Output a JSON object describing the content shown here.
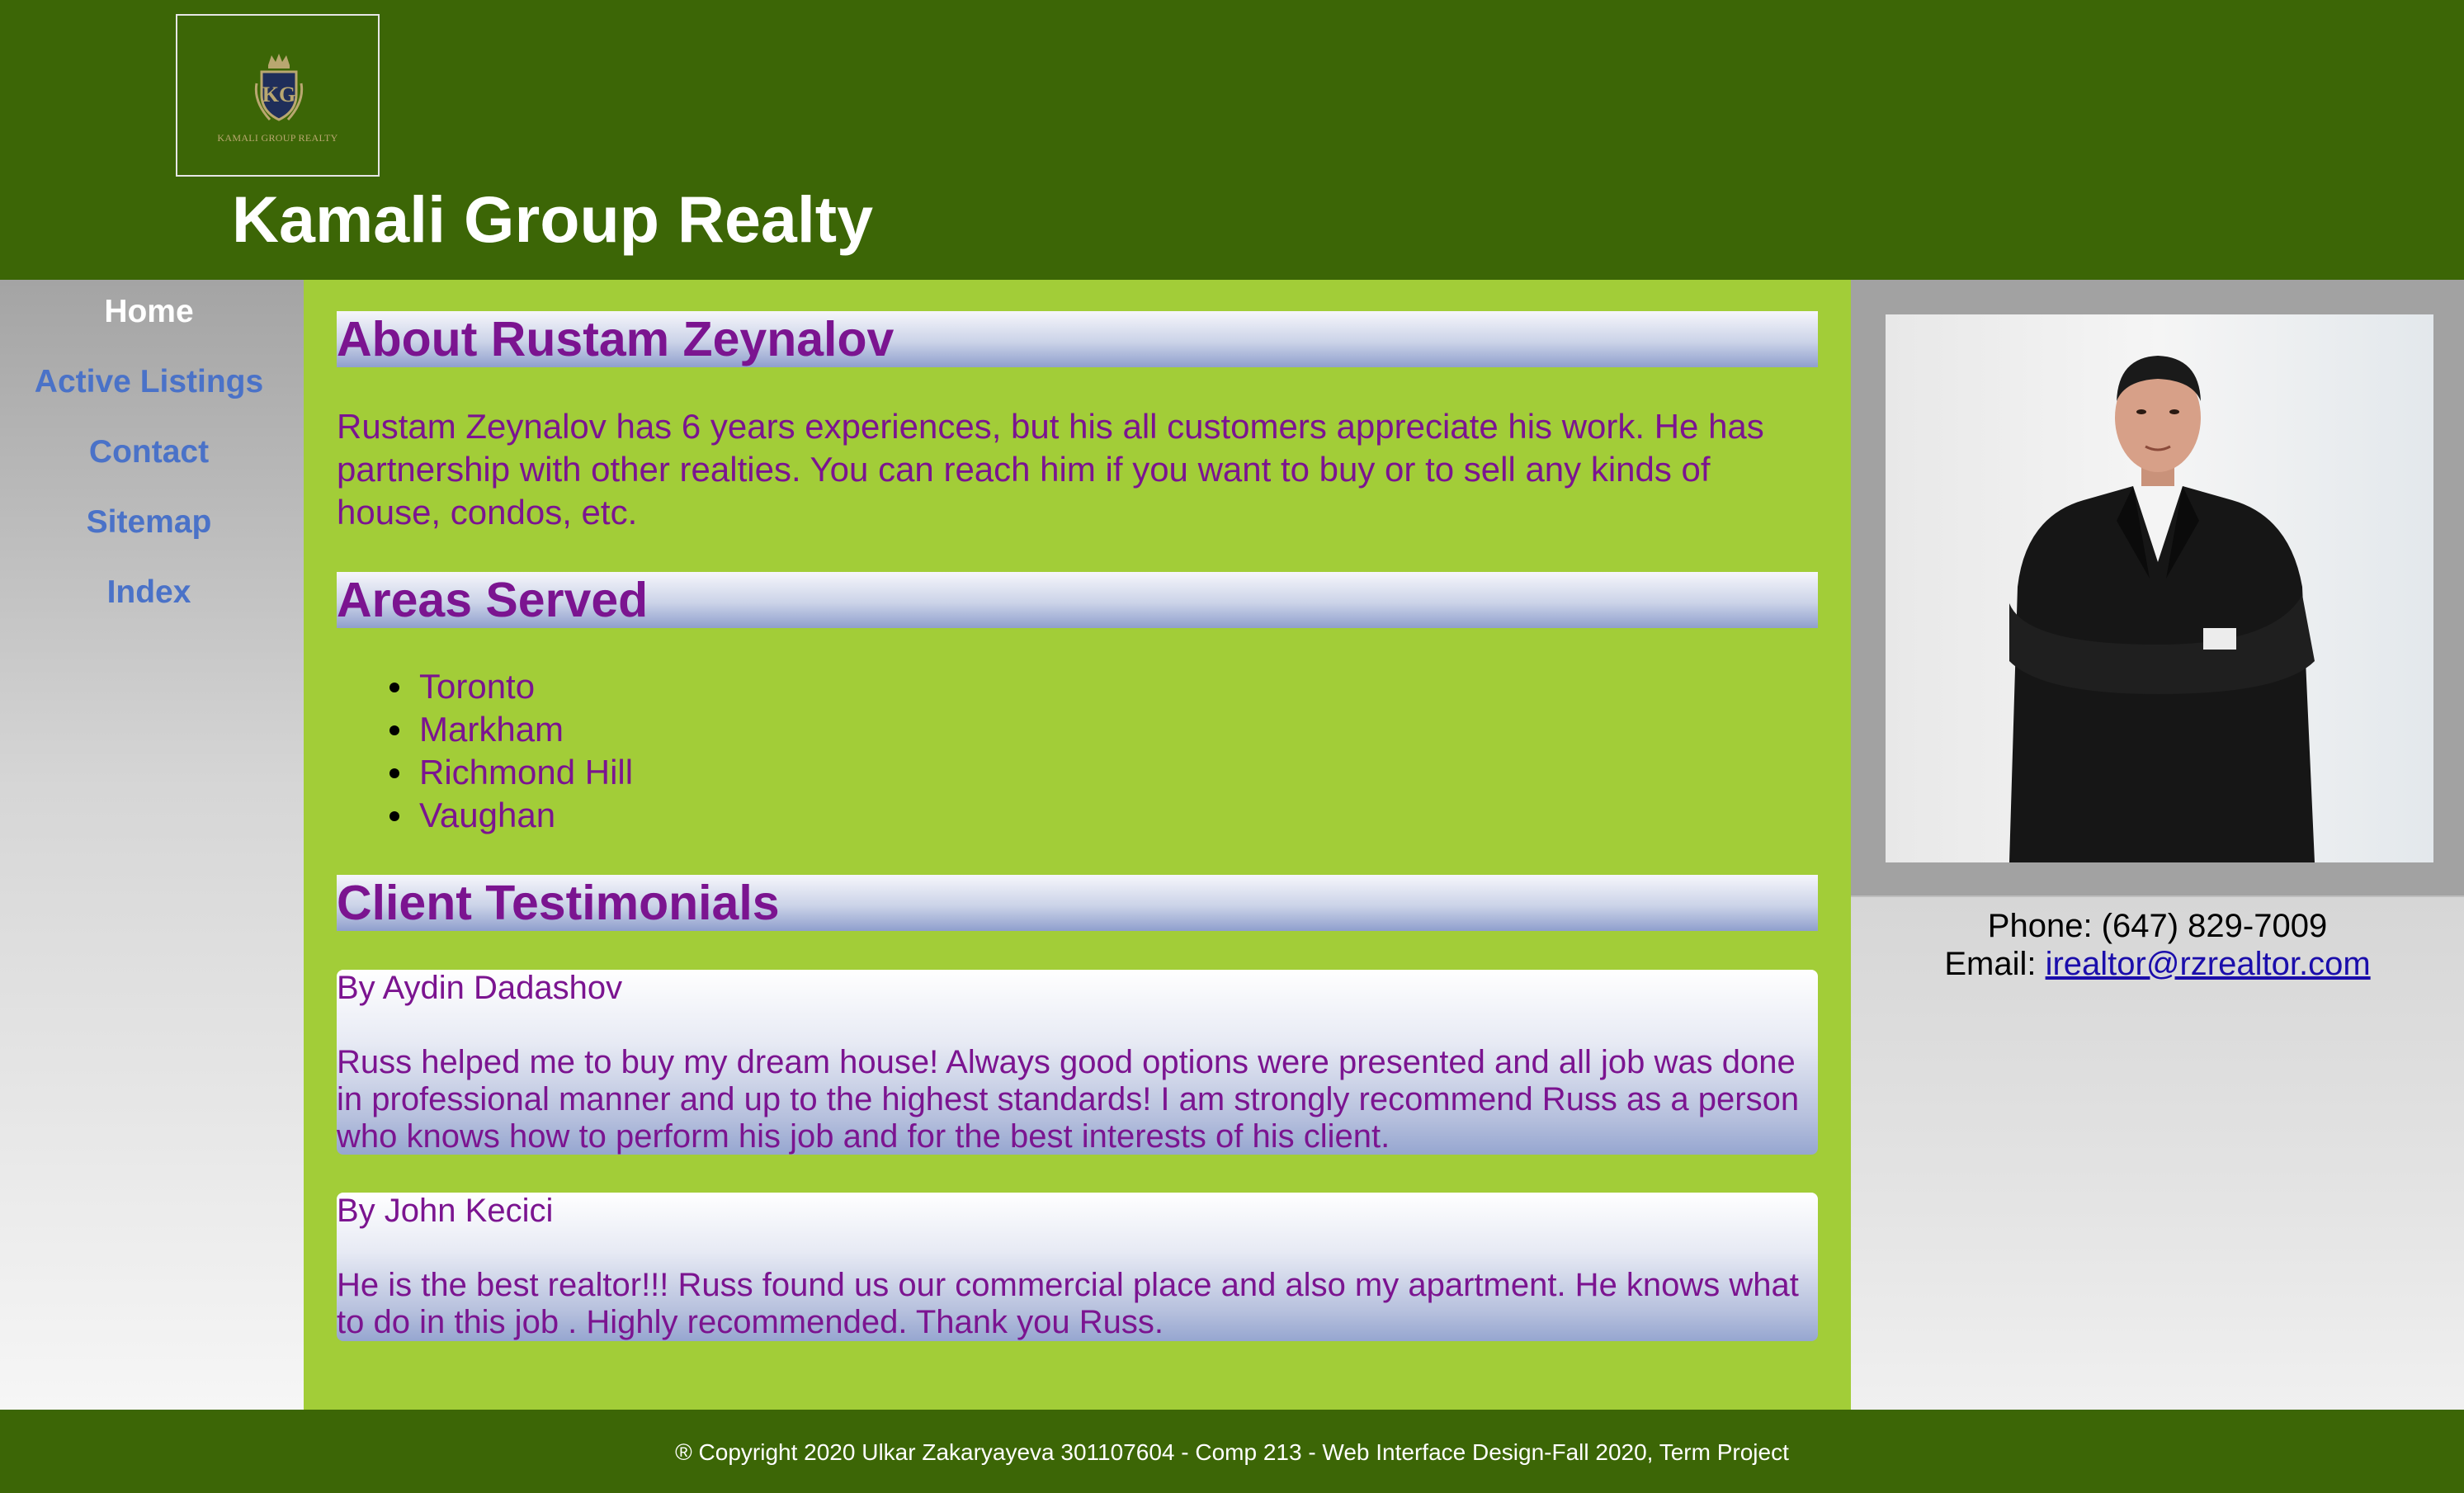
{
  "header": {
    "logo_text": "KAMALI GROUP REALTY",
    "logo_monogram": "KG",
    "site_title": "Kamali Group Realty"
  },
  "nav": {
    "items": [
      {
        "label": "Home",
        "active": true
      },
      {
        "label": "Active Listings",
        "active": false
      },
      {
        "label": "Contact",
        "active": false
      },
      {
        "label": "Sitemap",
        "active": false
      },
      {
        "label": "Index",
        "active": false
      }
    ]
  },
  "main": {
    "about": {
      "title": "About Rustam Zeynalov",
      "text": "Rustam Zeynalov has 6 years experiences, but his all customers appreciate his work. He has partnership with other realties. You can reach him if you want to buy or to sell any kinds of house, condos, etc."
    },
    "areas": {
      "title": "Areas Served",
      "items": [
        "Toronto",
        "Markham",
        "Richmond Hill",
        "Vaughan"
      ]
    },
    "testimonials": {
      "title": "Client Testimonials",
      "items": [
        {
          "author": "By Aydin Dadashov",
          "text": "Russ helped me to buy my dream house! Always good options were presented and all job was done in professional manner and up to the highest standards! I am strongly recommend Russ as a person who knows how to perform his job and for the best interests of his client."
        },
        {
          "author": "By John Kecici",
          "text": "He is the best realtor!!! Russ found us our commercial place and also my apartment. He knows what to do in this job . Highly recommended. Thank you Russ."
        }
      ]
    }
  },
  "aside": {
    "phone": "Phone: (647) 829-7009",
    "email_label": "Email: ",
    "email": "irealtor@rzrealtor.com"
  },
  "footer": {
    "text": "® Copyright 2020 Ulkar Zakaryayeva 301107604 - Comp 213 - Web Interface Design-Fall 2020, Term Project"
  },
  "colors": {
    "header_bg": "#3c6606",
    "main_bg": "#a2cd38",
    "heading_text": "#7b1490",
    "nav_link": "#4a72c8",
    "nav_active": "#ffffff",
    "email_link": "#1a0dab"
  }
}
